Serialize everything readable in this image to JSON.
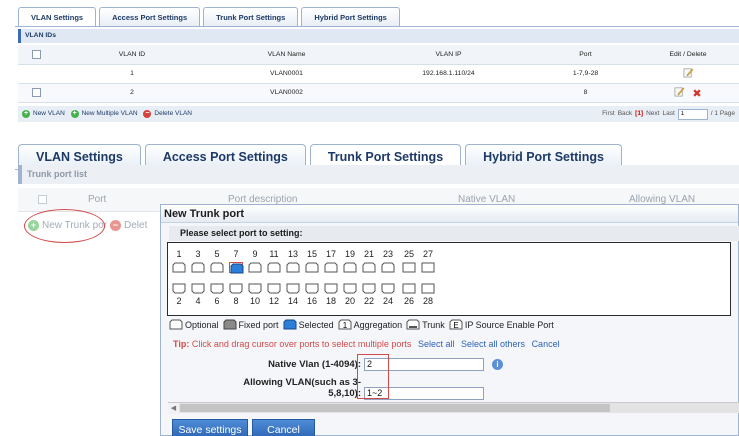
{
  "panel1": {
    "tabs": [
      "VLAN Settings",
      "Access Port Settings",
      "Trunk Port Settings",
      "Hybrid Port Settings"
    ],
    "section": "VLAN IDs",
    "columns": [
      "",
      "VLAN ID",
      "VLAN Name",
      "VLAN IP",
      "Port",
      "Edit / Delete"
    ],
    "rows": [
      {
        "id": "1",
        "name": "VLAN0001",
        "ip": "192.168.1.110/24",
        "port": "1-7,9-28"
      },
      {
        "id": "2",
        "name": "VLAN0002",
        "ip": "",
        "port": "8"
      }
    ],
    "actions": [
      "New VLAN",
      "New Multiple VLAN",
      "Delete VLAN"
    ],
    "pager": {
      "first": "First",
      "back": "Back",
      "current": "[1]",
      "next": "Next",
      "last": "Last",
      "input": "1",
      "total": "/ 1 Page"
    }
  },
  "panel2": {
    "tabs": [
      "VLAN Settings",
      "Access Port Settings",
      "Trunk Port Settings",
      "Hybrid Port Settings"
    ],
    "section": "Trunk port list",
    "columns": [
      "Port",
      "Port description",
      "Native VLAN",
      "Allowing VLAN"
    ],
    "actions": [
      "New Trunk por",
      "Delet"
    ]
  },
  "dialog": {
    "title": "New Trunk port",
    "prompt": "Please select port to setting:",
    "odd_ports": [
      "1",
      "3",
      "5",
      "7",
      "9",
      "11",
      "13",
      "15",
      "17",
      "19",
      "21",
      "23",
      "25",
      "27"
    ],
    "even_ports": [
      "2",
      "4",
      "6",
      "8",
      "10",
      "12",
      "14",
      "16",
      "18",
      "20",
      "22",
      "24",
      "26",
      "28"
    ],
    "selected_port": "7",
    "legend": {
      "optional": "Optional",
      "fixed": "Fixed port",
      "selected": "Selected",
      "aggregation_glyph": "1",
      "aggregation": "Aggregation",
      "trunk": "Trunk",
      "ipsource_glyph": "E",
      "ipsource": "IP Source Enable Port"
    },
    "tip": {
      "label": "Tip:",
      "text": " Click and drag cursor over ports to select multiple ports",
      "select_all": "Select all",
      "select_others": "Select all others",
      "cancel": "Cancel"
    },
    "native_vlan_label": "Native Vlan (1-4094):",
    "native_vlan_value": "2",
    "allowing_label_1": "Allowing VLAN(such as 3-",
    "allowing_label_2": "5,8,10):",
    "allowing_value": "1~2",
    "save_button": "Save settings",
    "cancel_button": "Cancel",
    "scroll_arrow": "◀"
  },
  "colors": {
    "accent": "#3c6cb3",
    "highlight": "#d24a4a",
    "selected_port": "#2b7fd8",
    "button": "#2c66b5"
  }
}
